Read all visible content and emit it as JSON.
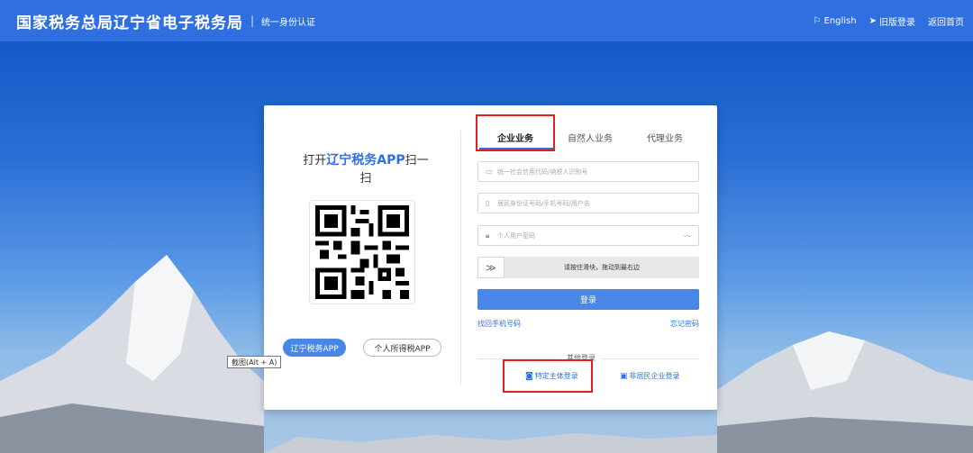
{
  "header": {
    "title": "国家税务总局辽宁省电子税务局",
    "separator": "|",
    "subtitle": "统一身份认证",
    "links": {
      "english": "English",
      "old_login": "旧版登录",
      "home": "返回首页"
    }
  },
  "qr": {
    "title_prefix": "打开",
    "title_brand": "辽宁税务APP",
    "title_suffix": "扫一扫",
    "btn_app": "辽宁税务APP",
    "btn_personal_tax": "个人所得税APP"
  },
  "tabs": [
    "企业业务",
    "自然人业务",
    "代理业务"
  ],
  "form": {
    "credit_code_placeholder": "统一社会信用代码/纳税人识别号",
    "id_placeholder": "居民身份证号码/手机号码/用户名",
    "password_placeholder": "个人用户密码",
    "slider_text": "请按住滑块，拖动到最右边",
    "slider_handle": "≫",
    "login": "登录",
    "find_phone": "找回手机号码",
    "forgot_password": "忘记密码"
  },
  "other_login": {
    "title": "其他登录",
    "specific_entity": "特定主体登录",
    "non_resident": "非居民企业登录"
  },
  "tooltip": "截图(Alt + A)",
  "colors": {
    "header": "#2f6fe0",
    "primary": "#4a86e8",
    "highlight": "#e02020"
  }
}
